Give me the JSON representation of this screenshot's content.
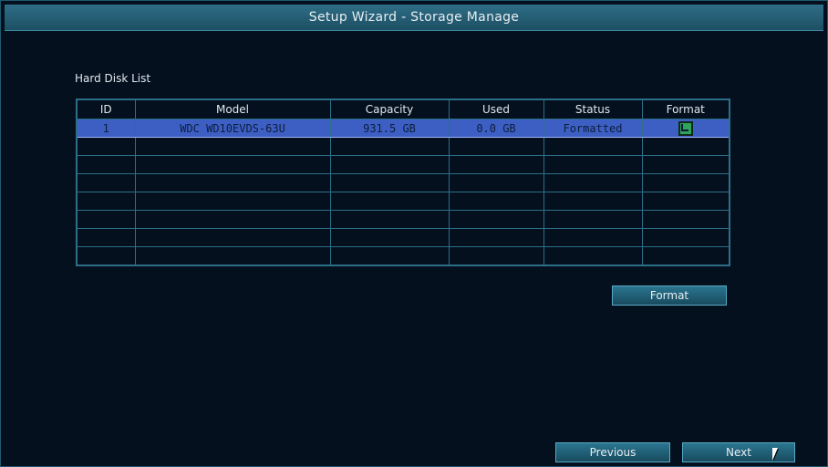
{
  "window": {
    "title": "Setup Wizard - Storage Manage"
  },
  "section": {
    "label": "Hard Disk List"
  },
  "table": {
    "columns": [
      "ID",
      "Model",
      "Capacity",
      "Used",
      "Status",
      "Format"
    ],
    "rows": [
      {
        "id": "1",
        "model": "WDC WD10EVDS-63U",
        "capacity": "931.5 GB",
        "used": "0.0 GB",
        "status": "Formatted",
        "format_checked": true
      }
    ],
    "empty_row_count": 7
  },
  "buttons": {
    "format_label": "Format",
    "previous_label": "Previous",
    "next_label": "Next"
  },
  "colors": {
    "title_bar": "#2e6e87",
    "background": "#05101f",
    "grid": "#2c6f86",
    "selection": "#3d5fc4"
  }
}
